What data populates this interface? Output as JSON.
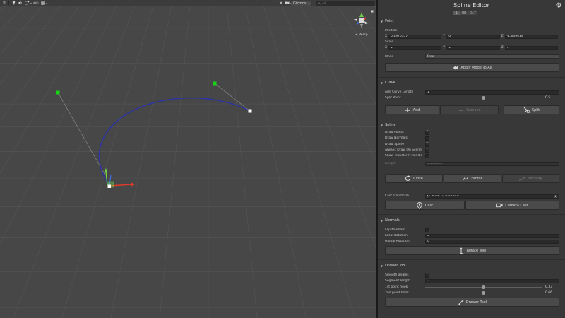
{
  "toolbar": {
    "tools": [
      "hand-tool",
      "light-toggle",
      "audio-toggle",
      "effects-toggle",
      "hidden-objects-toggle",
      "grid-toggle"
    ],
    "gizmos_label": "Gizmos",
    "search_placeholder": "All",
    "camera_label": "",
    "persp_label": "< Persp"
  },
  "inspector": {
    "title": "Spline Editor",
    "mode_toggle": [
      "1",
      "",
      "+T"
    ],
    "point": {
      "header": "Point",
      "position_label": "Position",
      "position": {
        "x": "0.2970357",
        "y": "0",
        "z": "-1.649419"
      },
      "scale_label": "Scale",
      "scale": {
        "x": "1",
        "y": "1",
        "z": "1"
      },
      "mode_label": "Mode",
      "mode_value": "Free",
      "apply_mode_label": "Apply Mode To All"
    },
    "curve": {
      "header": "Curve",
      "add_curve_length_label": "Add Curve Length",
      "add_curve_length_value": "1",
      "split_point_label": "Split Point",
      "split_point_value": "0.5",
      "split_point_fraction": 0.5,
      "add_label": "Add",
      "remove_label": "Remove",
      "split_label": "Split"
    },
    "spline": {
      "header": "Spline",
      "draw_points_label": "Draw Points",
      "draw_points": true,
      "draw_normals_label": "Draw Normals",
      "draw_normals": false,
      "draw_spline_label": "Draw Spline",
      "draw_spline": true,
      "always_draw_label": "Always Draw On Scene",
      "always_draw": true,
      "show_transform_label": "Show Transform Handle",
      "show_transform": false,
      "length_label": "Length",
      "length_value": "6.256863",
      "close_label": "Close",
      "factor_label": "Factor",
      "simplify_label": "Simplify",
      "cast_transform_label": "Cast Transform",
      "cast_transform_value": "None (Transform)",
      "cast_label": "Cast",
      "camera_cast_label": "Camera Cast"
    },
    "normals": {
      "header": "Normals",
      "flip_normals_label": "Flip Normals",
      "flip_normals": false,
      "local_rotation_label": "Local Rotation",
      "local_rotation_value": "0",
      "global_rotation_label": "Global Rotation",
      "global_rotation_value": "0",
      "rotate_tool_label": "Rotate Tool"
    },
    "drawer": {
      "header": "Drawer Tool",
      "smooth_angles_label": "Smooth angles",
      "smooth_angles": true,
      "segment_length_label": "Segment length",
      "segment_length_value": "5",
      "first_hook_label": "1st point hook",
      "first_hook_value": "0.33",
      "first_hook_fraction": 0.5,
      "second_hook_label": "2nd point hook",
      "second_hook_value": "0.66",
      "second_hook_fraction": 0.5,
      "drawer_tool_label": "Drawer Tool"
    }
  },
  "colors": {
    "spline": "#2a34a8",
    "point_green": "#17d417",
    "axis_x": "#e03a2a",
    "axis_y": "#6fd04a",
    "axis_z": "#3f6fd8"
  }
}
